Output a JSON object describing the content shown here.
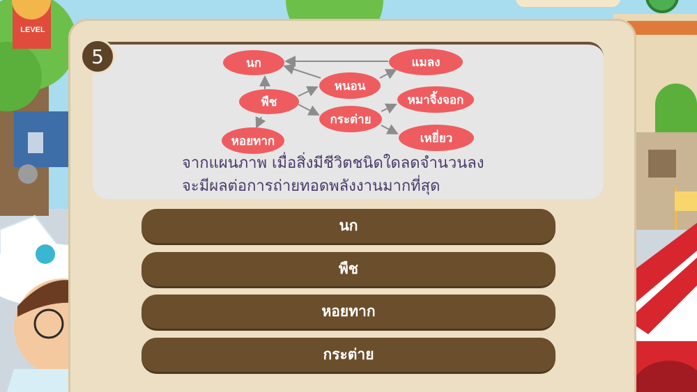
{
  "question": {
    "number": "5",
    "text_line1": "จากแผนภาพ เมื่อสิ่งมีชีวิตชนิดใดลดจำนวนลง",
    "text_line2": "จะมีผลต่อการถ่ายทอดพลังงานมากที่สุด"
  },
  "food_web": {
    "nodes": [
      {
        "id": "bird",
        "label": "นก"
      },
      {
        "id": "plant",
        "label": "พืช"
      },
      {
        "id": "snail",
        "label": "หอยทาก"
      },
      {
        "id": "caterpillar",
        "label": "หนอน"
      },
      {
        "id": "rabbit",
        "label": "กระต่าย"
      },
      {
        "id": "insect",
        "label": "แมลง"
      },
      {
        "id": "wolf",
        "label": "หมาจิ้งจอก"
      },
      {
        "id": "hawk",
        "label": "เหยี่ยว"
      }
    ]
  },
  "answers": [
    {
      "label": "นก"
    },
    {
      "label": "พืช"
    },
    {
      "label": "หอยทาก"
    },
    {
      "label": "กระต่าย"
    }
  ],
  "hud": {
    "level_label": "LEVEL"
  },
  "colors": {
    "node": "#ef5c5f",
    "answer": "#6b4e2c",
    "panel": "#eddfc4",
    "accent_number": "#5c4328"
  }
}
